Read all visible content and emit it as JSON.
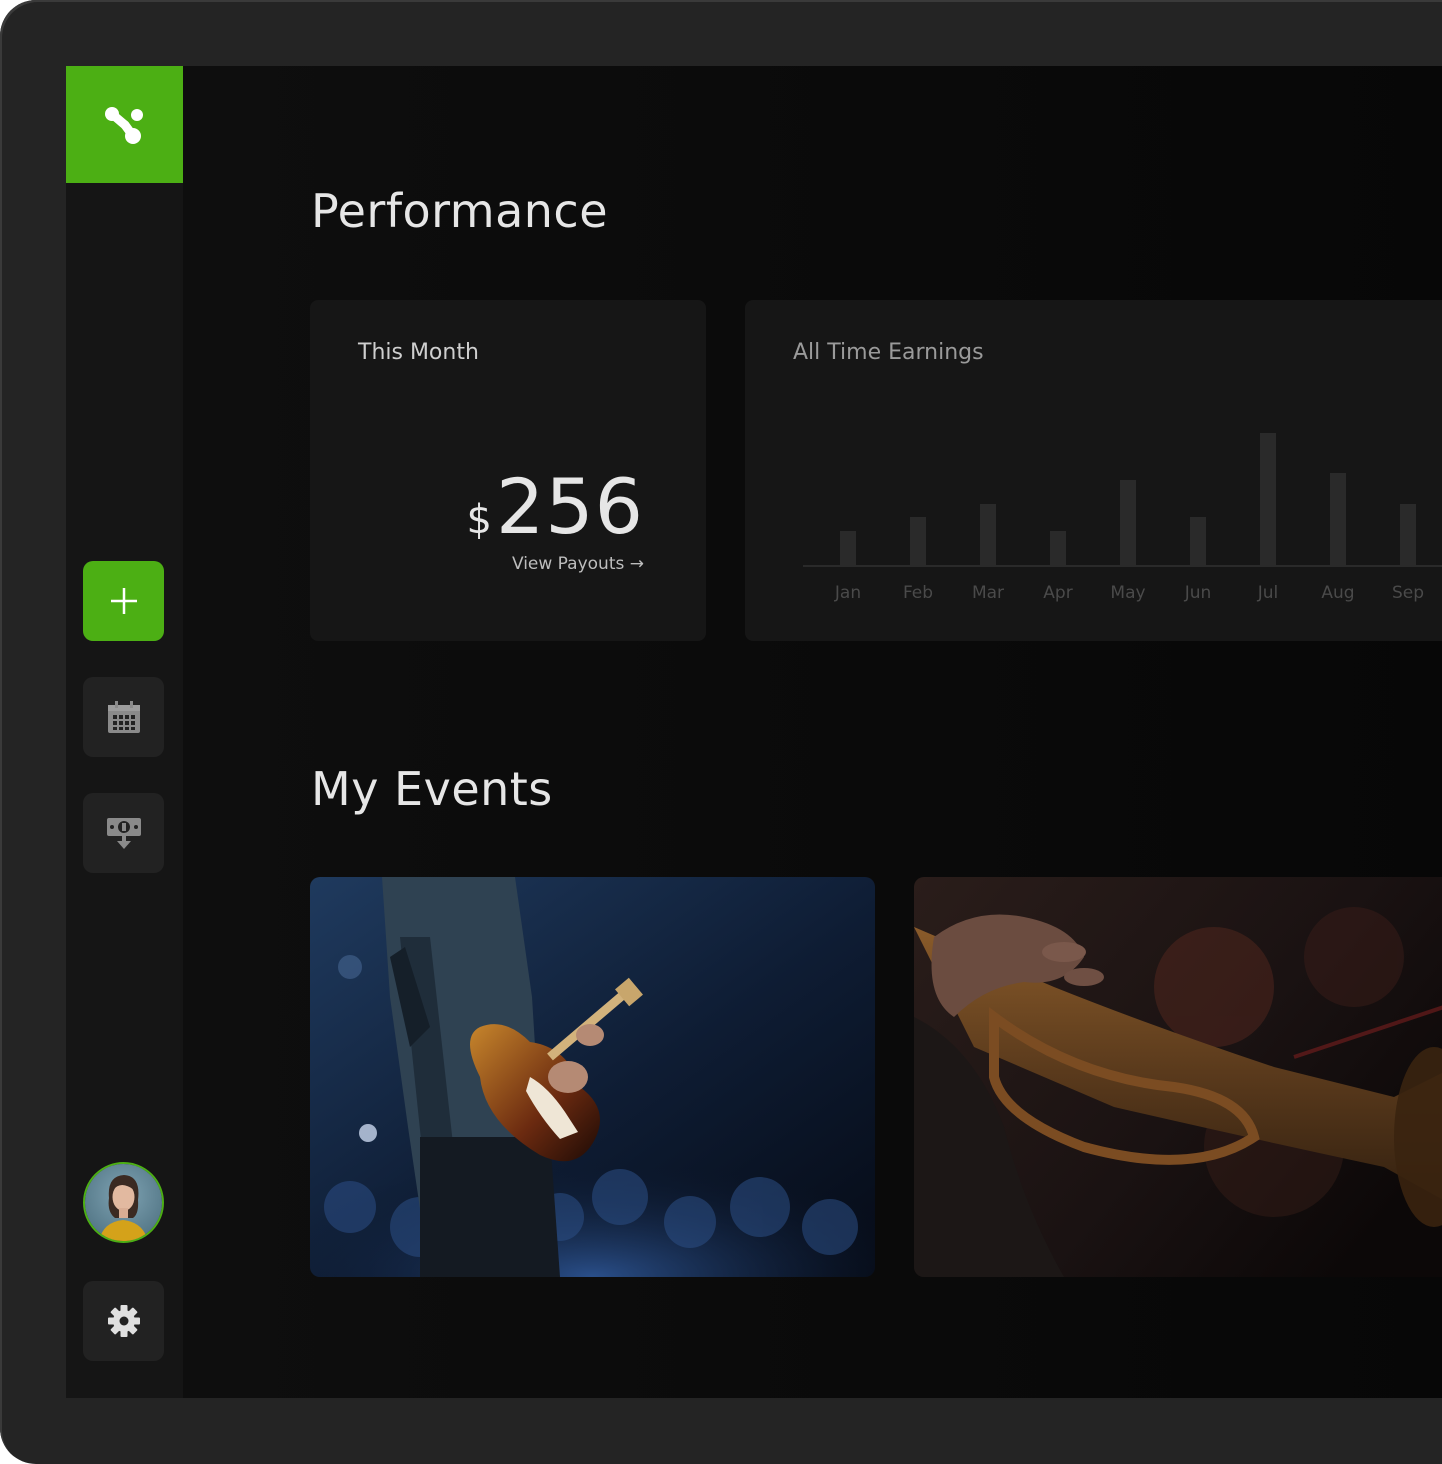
{
  "colors": {
    "accent": "#4caf14",
    "background": "#0b0b0b",
    "card": "#161616"
  },
  "sidebar": {
    "logo": "brand-logo-icon",
    "buttons": [
      {
        "name": "add-button",
        "icon": "plus-icon"
      },
      {
        "name": "calendar-button",
        "icon": "calendar-icon"
      },
      {
        "name": "payout-button",
        "icon": "money-download-icon"
      }
    ],
    "avatar": "user-avatar",
    "settings": "gear-icon"
  },
  "performance": {
    "title": "Performance",
    "this_month": {
      "label": "This Month",
      "currency": "$",
      "amount": "256",
      "link": "View Payouts →"
    },
    "all_time": {
      "label": "All Time Earnings"
    }
  },
  "chart_data": {
    "type": "bar",
    "categories": [
      "Jan",
      "Feb",
      "Mar",
      "Apr",
      "May",
      "Jun",
      "Jul",
      "Aug",
      "Sep"
    ],
    "values": [
      35,
      49,
      62,
      35,
      86,
      49,
      133,
      93,
      62
    ],
    "grid": false
  },
  "events": {
    "title": "My Events",
    "items": [
      {
        "name": "guitar-concert-event",
        "image": "guitarist-on-stage"
      },
      {
        "name": "trumpet-jazz-event",
        "image": "trumpet-player"
      }
    ]
  }
}
